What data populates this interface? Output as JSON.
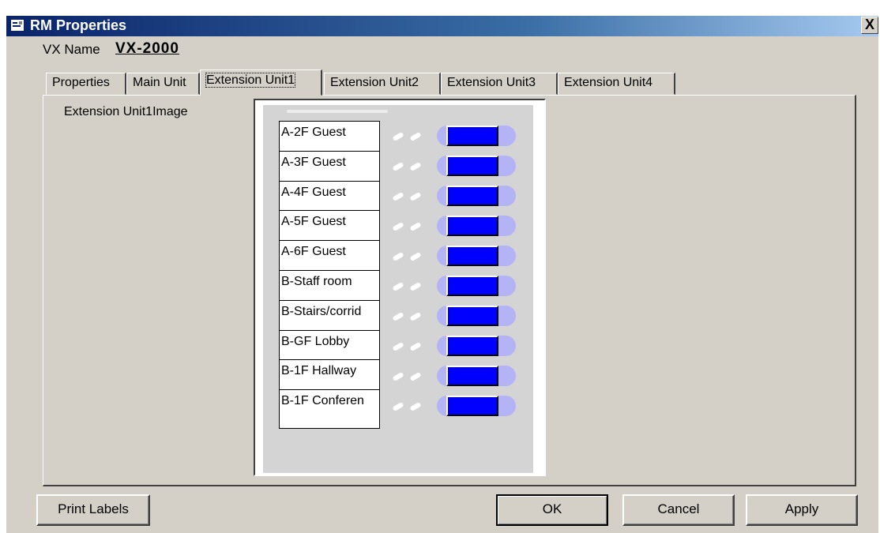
{
  "window": {
    "title": "RM Properties",
    "close_label": "X"
  },
  "vx": {
    "name_label": "VX Name",
    "name_value": "VX-2000"
  },
  "tabs": [
    {
      "label": "Properties"
    },
    {
      "label": "Main Unit"
    },
    {
      "label": "Extension Unit1",
      "active": true
    },
    {
      "label": "Extension Unit2"
    },
    {
      "label": "Extension Unit3"
    },
    {
      "label": "Extension Unit4"
    }
  ],
  "panel": {
    "image_label": "Extension Unit1Image",
    "labels": [
      "A-2F Guest",
      "A-3F Guest",
      "A-4F Guest",
      "A-5F Guest",
      "A-6F Guest",
      "B-Staff room",
      "B-Stairs/corrid",
      "B-GF Lobby",
      "B-1F Hallway",
      "B-1F Conferen"
    ]
  },
  "buttons": {
    "print_labels": "Print Labels",
    "ok": "OK",
    "cancel": "Cancel",
    "apply": "Apply"
  },
  "colors": {
    "button_blue": "#0000ff",
    "title_gradient_start": "#0a246a",
    "title_gradient_end": "#a6caf0",
    "face": "#d4d0c8"
  }
}
